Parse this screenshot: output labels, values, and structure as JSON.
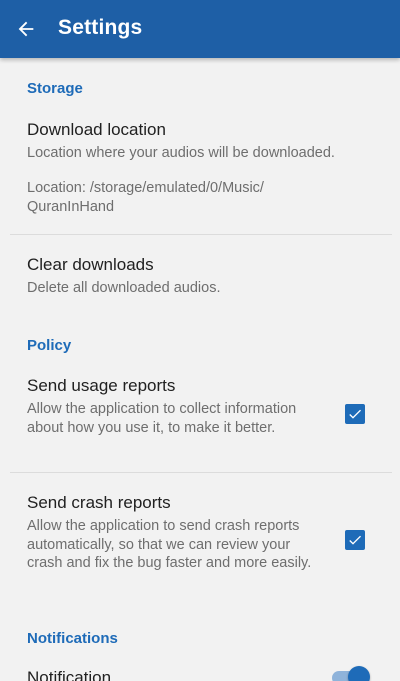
{
  "appbar": {
    "title": "Settings",
    "back_icon": "arrow-left-icon",
    "background": "#1e5fa6"
  },
  "storage": {
    "header": "Storage",
    "download_location": {
      "title": "Download location",
      "summary": "Location where your audios will be downloaded.",
      "location_line1": "Location: /storage/emulated/0/Music/",
      "location_line2": "QuranInHand"
    },
    "clear_downloads": {
      "title": "Clear downloads",
      "summary": "Delete all downloaded audios."
    }
  },
  "policy": {
    "header": "Policy",
    "usage_reports": {
      "title": "Send usage reports",
      "summary": "Allow the application to collect information about how you use it, to make it better.",
      "checked": true
    },
    "crash_reports": {
      "title": "Send crash reports",
      "summary": "Allow the application to send crash reports automatically, so that we can review your crash and fix the bug faster and more easily.",
      "checked": true
    }
  },
  "notifications": {
    "header": "Notifications",
    "notification": {
      "title": "Notification",
      "enabled": true
    }
  },
  "colors": {
    "accent": "#1e6bb8",
    "section_header": "#1e6bb8",
    "background": "#f2f2f2"
  }
}
